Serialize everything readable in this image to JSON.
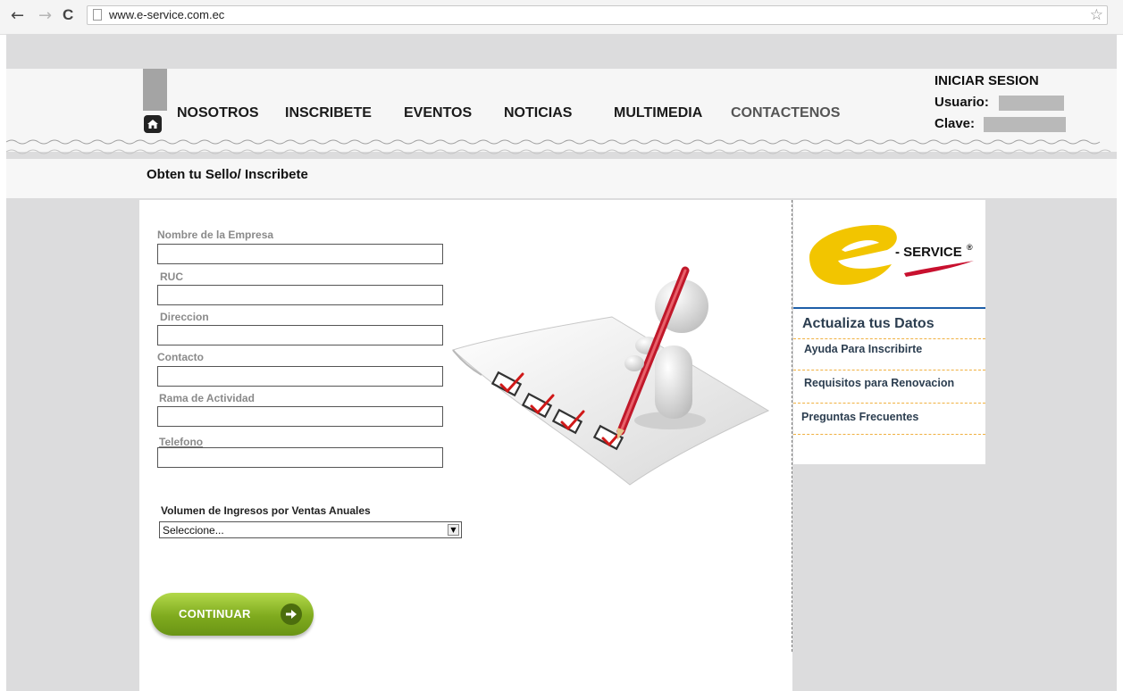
{
  "browser": {
    "url": "www.e-service.com.ec",
    "back_icon": "←",
    "forward_icon": "→",
    "reload_icon": "C",
    "star_icon": "☆"
  },
  "nav": {
    "items": [
      "NOSOTROS",
      "INSCRIBETE",
      "EVENTOS",
      "NOTICIAS",
      "MULTIMEDIA",
      "CONTACTENOS"
    ]
  },
  "login": {
    "title": "INICIAR SESION",
    "user_label": "Usuario:",
    "password_label": "Clave:"
  },
  "page": {
    "title": "Obten tu Sello/ Inscribete"
  },
  "form": {
    "fields": [
      {
        "label": "Nombre de la Empresa",
        "value": ""
      },
      {
        "label": "RUC",
        "value": ""
      },
      {
        "label": "Direccion",
        "value": ""
      },
      {
        "label": "Contacto",
        "value": ""
      },
      {
        "label": "Rama de Actividad",
        "value": ""
      },
      {
        "label": "Telefono",
        "value": ""
      }
    ],
    "volume_label": "Volumen de Ingresos por Ventas Anuales",
    "volume_selected": "Seleccione...",
    "continue_label": "CONTINUAR"
  },
  "sidebar": {
    "logo_text": "- SERVICE",
    "logo_reg": "®",
    "section_title": "Actualiza tus Datos",
    "links": [
      "Ayuda Para Inscribirte",
      "Requisitos para Renovacion",
      "Preguntas Frecuentes"
    ]
  },
  "colors": {
    "accent_green": "#7faa1e",
    "sidebar_link": "#2c3e50",
    "logo_yellow": "#f2c500",
    "logo_red": "#c8102e"
  }
}
